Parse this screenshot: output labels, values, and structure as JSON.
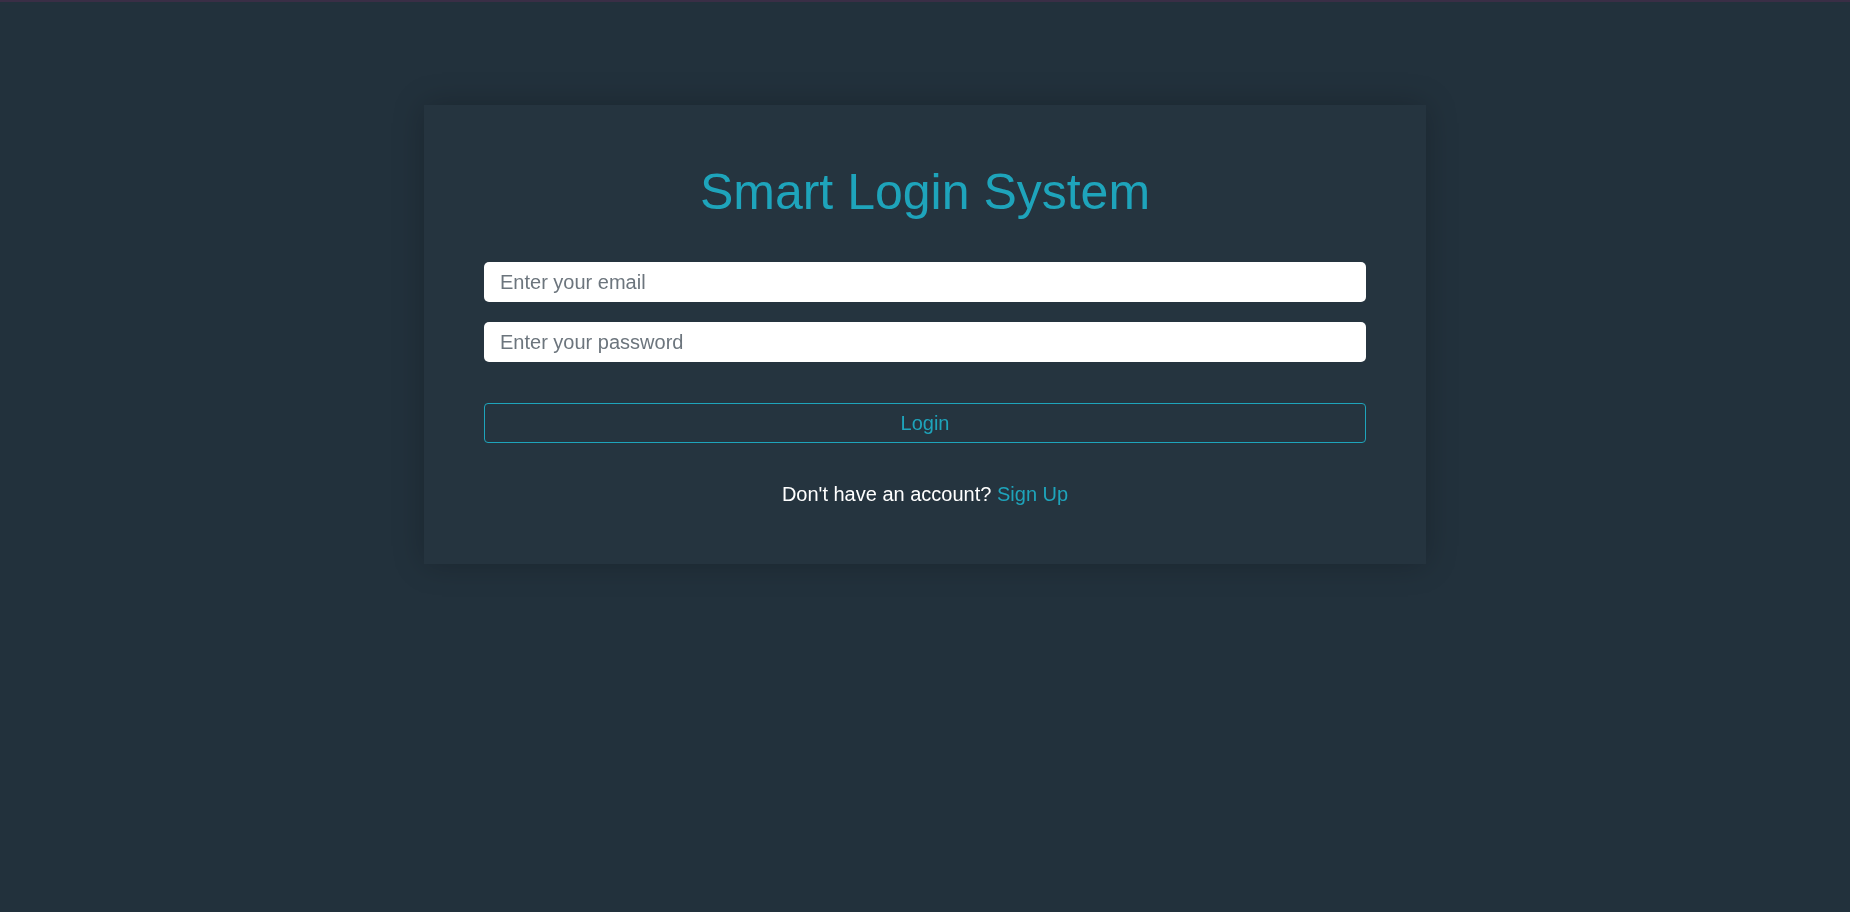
{
  "title": "Smart Login System",
  "fields": [
    {
      "placeholder": "Enter your email"
    },
    {
      "placeholder": "Enter your password"
    }
  ],
  "login_button": "Login",
  "signup_prompt": {
    "text": "Don't have an account?",
    "link": "Sign Up"
  }
}
